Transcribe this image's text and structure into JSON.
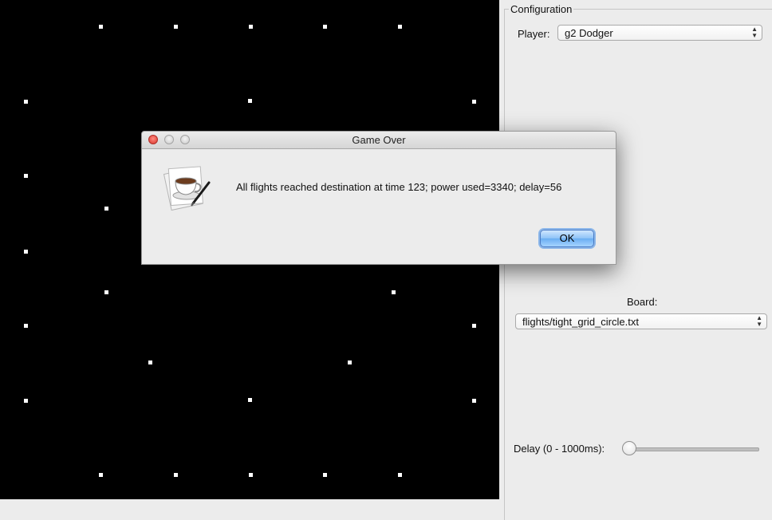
{
  "config": {
    "group_title": "Configuration",
    "player_label": "Player:",
    "player_value": "g2 Dodger",
    "board_label": "Board:",
    "board_value": "flights/tight_grid_circle.txt",
    "delay_label": "Delay (0 - 1000ms):",
    "delay_value": 0
  },
  "dialog": {
    "title": "Game Over",
    "message": "All flights reached destination at time 123; power used=3340; delay=56",
    "ok_label": "OK",
    "app_icon": "java-coffee-cup-icon"
  },
  "board": {
    "background": "#000000",
    "dot_color": "#ffffff"
  }
}
